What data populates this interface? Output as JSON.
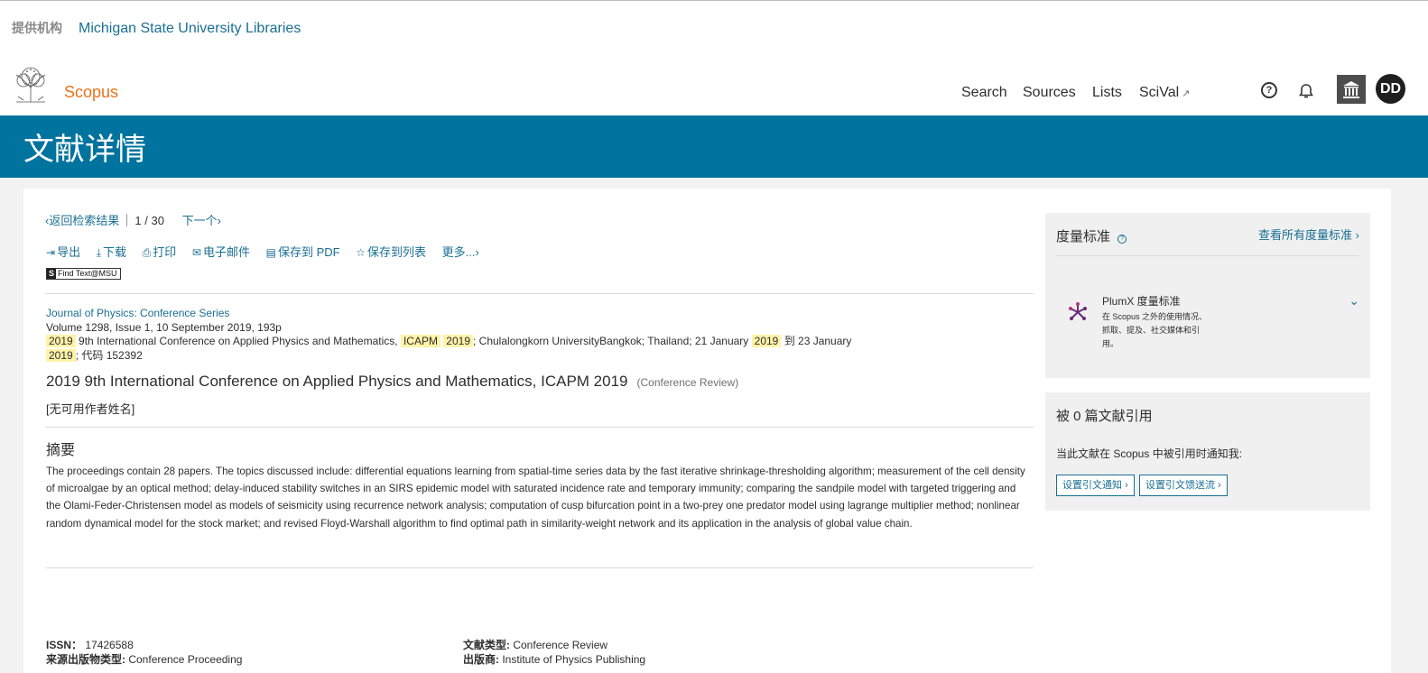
{
  "header": {
    "institution_label": "提供机构",
    "institution_name": "Michigan State University Libraries",
    "brand": "Scopus",
    "nav": {
      "search": "Search",
      "sources": "Sources",
      "lists": "Lists",
      "scival": "SciVal",
      "scival_ext_icon": "↗"
    },
    "help_glyph": "?",
    "avatar_initials": "DD"
  },
  "banner": {
    "title": "文献详情"
  },
  "breadcrumbs": {
    "back": "返回检索结果",
    "position": "1",
    "slash": "/",
    "total": "30",
    "next": "下一个"
  },
  "toolbar": {
    "export": "导出",
    "download": "下载",
    "print": "打印",
    "email": "电子邮件",
    "save_pdf": "保存到 PDF",
    "save_list": "保存到列表",
    "more": "更多..."
  },
  "find_text": {
    "badge": "S",
    "label": "Find Text@MSU"
  },
  "source": {
    "journal": "Journal of Physics: Conference Series",
    "volume_line": "Volume 1298, Issue 1, 10 September 2019, 193p",
    "year": "2019",
    "conf_part1": "9th International Conference on Applied Physics and Mathematics,",
    "acronym": "ICAPM",
    "conf_part2": "; Chulalongkorn UniversityBangkok; Thailand; 21 January",
    "to_label": "到 23 January",
    "code_suffix": "; 代码 152392"
  },
  "document": {
    "title": "2019 9th International Conference on Applied Physics and Mathematics, ICAPM 2019",
    "type": "(Conference Review)",
    "authors": "[无可用作者姓名]"
  },
  "abstract": {
    "heading": "摘要",
    "text": "The proceedings contain 28 papers. The topics discussed include: differential equations learning from spatial-time series data by the fast iterative shrinkage-thresholding algorithm; measurement of the cell density of microalgae by an optical method; delay-induced stability switches in an SIRS epidemic model with saturated incidence rate and temporary immunity; comparing the sandpile model with targeted triggering and the Olami-Feder-Christensen model as models of seismicity using recurrence network analysis; computation of cusp bifurcation point in a two-prey one predator model using lagrange multiplier method; nonlinear random dynamical model for the stock market; and revised Floyd-Warshall algorithm to find optimal path in similarity-weight network and its application in the analysis of global value chain."
  },
  "metadata": {
    "issn_label": "ISSN：",
    "issn": "17426588",
    "source_type_label": "来源出版物类型:",
    "source_type": "Conference Proceeding",
    "doc_type_label": "文献类型:",
    "doc_type": "Conference Review",
    "publisher_label": "出版商:",
    "publisher": "Institute of Physics Publishing"
  },
  "metrics_panel": {
    "title": "度量标准",
    "help_glyph": "?",
    "view_all": "查看所有度量标准",
    "plumx_title": "PlumX 度量标准",
    "plumx_desc": "在 Scopus 之外的使用情况、抓取、提及、社交媒体和引用。"
  },
  "citations_panel": {
    "title": "被 0 篇文献引用",
    "desc": "当此文献在 Scopus 中被引用时通知我:",
    "alert_button": "设置引文通知",
    "feed_button": "设置引文馈送流"
  },
  "colors": {
    "banner": "#00739e",
    "link": "#1a6f93",
    "brand": "#e9711c",
    "highlight": "#fff3a8"
  }
}
